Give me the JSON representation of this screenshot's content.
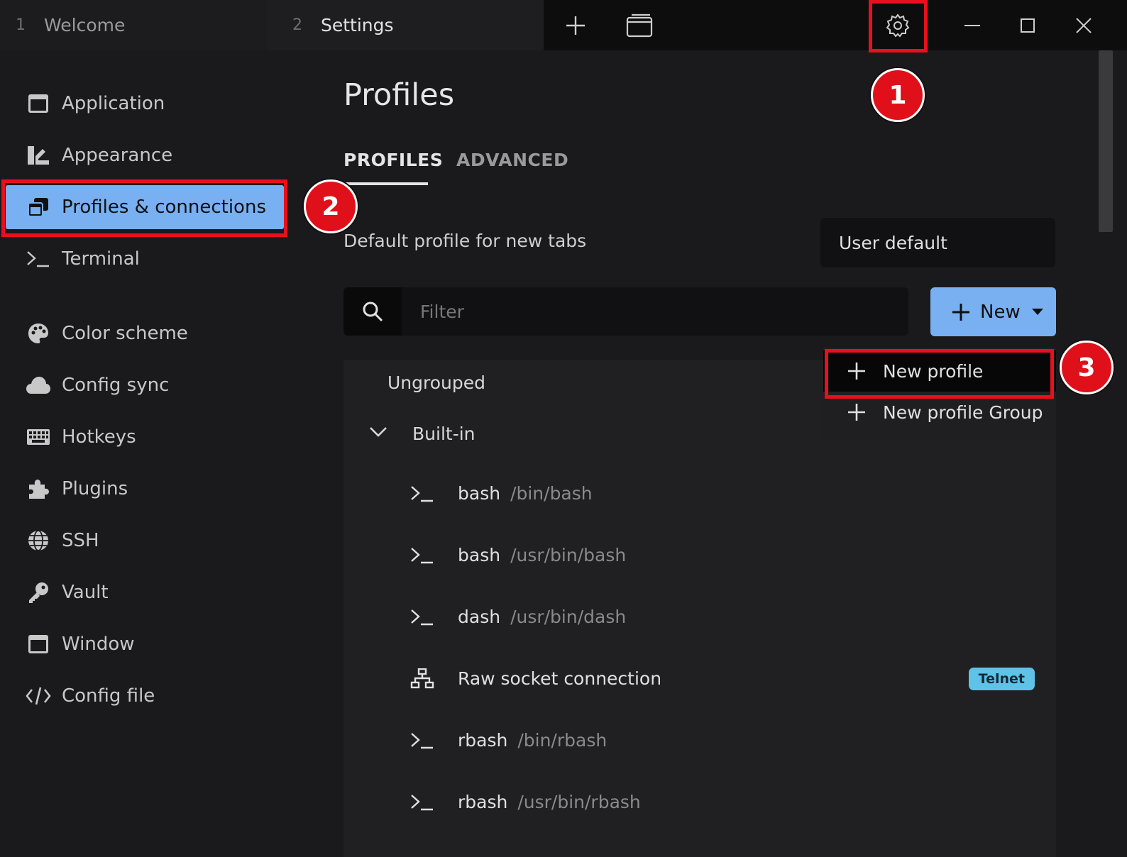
{
  "tabs": [
    {
      "num": "1",
      "title": "Welcome"
    },
    {
      "num": "2",
      "title": "Settings"
    }
  ],
  "titlebar_icons": [
    "plus-icon",
    "window-icon",
    "gear-icon",
    "minimize-icon",
    "maximize-icon",
    "close-icon"
  ],
  "sidebar": {
    "items": [
      {
        "label": "Application",
        "icon": "application-icon"
      },
      {
        "label": "Appearance",
        "icon": "appearance-icon"
      },
      {
        "label": "Profiles & connections",
        "icon": "profiles-icon",
        "active": true
      },
      {
        "label": "Terminal",
        "icon": "terminal-icon"
      },
      {
        "label": "Color scheme",
        "icon": "palette-icon"
      },
      {
        "label": "Config sync",
        "icon": "cloud-icon"
      },
      {
        "label": "Hotkeys",
        "icon": "keyboard-icon"
      },
      {
        "label": "Plugins",
        "icon": "puzzle-icon"
      },
      {
        "label": "SSH",
        "icon": "globe-icon"
      },
      {
        "label": "Vault",
        "icon": "key-icon"
      },
      {
        "label": "Window",
        "icon": "window-icon"
      },
      {
        "label": "Config file",
        "icon": "code-icon"
      }
    ]
  },
  "main": {
    "title": "Profiles",
    "tabs": [
      {
        "label": "PROFILES",
        "active": true
      },
      {
        "label": "ADVANCED",
        "active": false
      }
    ],
    "default_profile_label": "Default profile for new tabs",
    "default_profile_value": "User default",
    "filter_placeholder": "Filter",
    "new_button_label": "New",
    "groups": {
      "ungrouped": "Ungrouped",
      "builtin": "Built-in"
    },
    "profiles": [
      {
        "name": "bash",
        "cmd": "/bin/bash",
        "icon": "terminal-icon"
      },
      {
        "name": "bash",
        "cmd": "/usr/bin/bash",
        "icon": "terminal-icon"
      },
      {
        "name": "dash",
        "cmd": "/usr/bin/dash",
        "icon": "terminal-icon"
      },
      {
        "name": "Raw socket connection",
        "cmd": "",
        "icon": "network-icon",
        "badge": "Telnet"
      },
      {
        "name": "rbash",
        "cmd": "/bin/rbash",
        "icon": "terminal-icon"
      },
      {
        "name": "rbash",
        "cmd": "/usr/bin/rbash",
        "icon": "terminal-icon"
      }
    ]
  },
  "dropdown": {
    "items": [
      "New profile",
      "New profile Group"
    ]
  },
  "markers": [
    "1",
    "2",
    "3"
  ],
  "colors": {
    "accent": "#78b0f2",
    "highlight": "#e8101c",
    "badge": "#5fc3e8"
  }
}
